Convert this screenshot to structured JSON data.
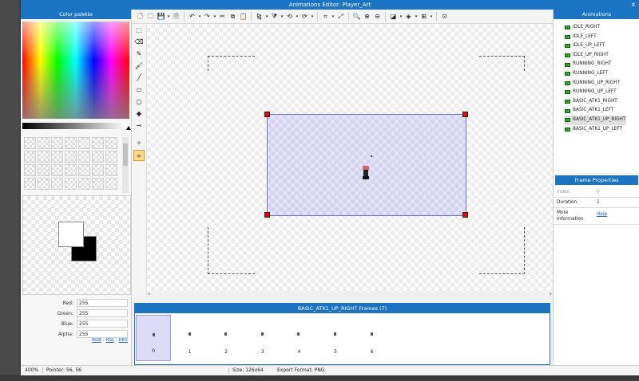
{
  "window": {
    "title": "Animations Editor: Player_Art",
    "close_glyph": "×"
  },
  "color_palette": {
    "title": "Color palette",
    "foreground": "#ffffff",
    "background": "#000000",
    "channels": [
      {
        "label": "Red:",
        "value": "255"
      },
      {
        "label": "Green:",
        "value": "255"
      },
      {
        "label": "Blue:",
        "value": "255"
      },
      {
        "label": "Alpha:",
        "value": "255"
      }
    ],
    "modes": {
      "rgb": "RGB",
      "hsl": "HSL",
      "hex": "HEX",
      "sep": " - "
    }
  },
  "toolbar": {
    "icons": [
      "new-file-icon",
      "open-folder-icon",
      "save-icon",
      "save-dropdown-icon",
      "save-as-icon",
      "undo-icon",
      "undo-dropdown-icon",
      "redo-icon",
      "redo-dropdown-icon",
      "cut-icon",
      "copy-icon",
      "paste-icon",
      "flip-horizontal-icon",
      "flip-horizontal-dropdown-icon",
      "flip-vertical-icon",
      "flip-vertical-dropdown-icon",
      "rotate-left-icon",
      "rotate-left-dropdown-icon",
      "rotate-right-icon",
      "rotate-right-dropdown-icon",
      "crop-icon",
      "crop-dropdown-icon",
      "resize-icon",
      "zoom-fit-icon",
      "zoom-in-icon",
      "zoom-out-icon",
      "background-icon",
      "background-dropdown-icon",
      "layers-icon",
      "layers-dropdown-icon",
      "grid-icon",
      "grid-dropdown-icon",
      "onion-skin-icon"
    ]
  },
  "tools": {
    "icons": [
      "selection-icon",
      "eraser-icon",
      "pencil-icon",
      "brush-icon",
      "line-icon",
      "rectangle-icon",
      "ellipse-icon",
      "fill-bucket-icon",
      "eyedropper-icon",
      "pivot-icon",
      "bone-icon"
    ],
    "active": "bone-icon"
  },
  "frames_panel": {
    "title": "BASIC_ATK1_UP_RIGHT Frames (7)",
    "frames": [
      "0",
      "1",
      "2",
      "3",
      "4",
      "5",
      "6"
    ],
    "selected": 0
  },
  "animations_panel": {
    "title": "Animations",
    "items": [
      "IDLE_RIGHT",
      "IDLE_LEFT",
      "IDLE_UP_LEFT",
      "IDLE_UP_RIGHT",
      "RUNNING_RIGHT",
      "RUNNING_LEFT",
      "RUNNING_UP_RIGHT",
      "RUNNING_UP_LEFT",
      "BASIC_ATK1_RIGHT",
      "BASIC_ATK1_LEFT",
      "BASIC_ATK1_UP_RIGHT",
      "BASIC_ATK1_UP_LEFT"
    ],
    "selected": 10,
    "icon": "animation-strip-icon"
  },
  "frame_properties": {
    "title": "Frame Properties",
    "index_label": "Index",
    "index_value": "0",
    "duration_label": "Duration",
    "duration_value": "1",
    "more_label_1": "More",
    "more_label_2": "Information",
    "help_link": "Help"
  },
  "status_bar": {
    "zoom": "400%",
    "pointer": "Pointer: 56, 56",
    "size": "Size: 126x64",
    "export_format": "Export Format: PNG"
  },
  "colors": {
    "accent": "#1b73c4",
    "selection_border": "#6d72e0",
    "handle": "#d01010",
    "active_tool": "#ffd98a"
  }
}
